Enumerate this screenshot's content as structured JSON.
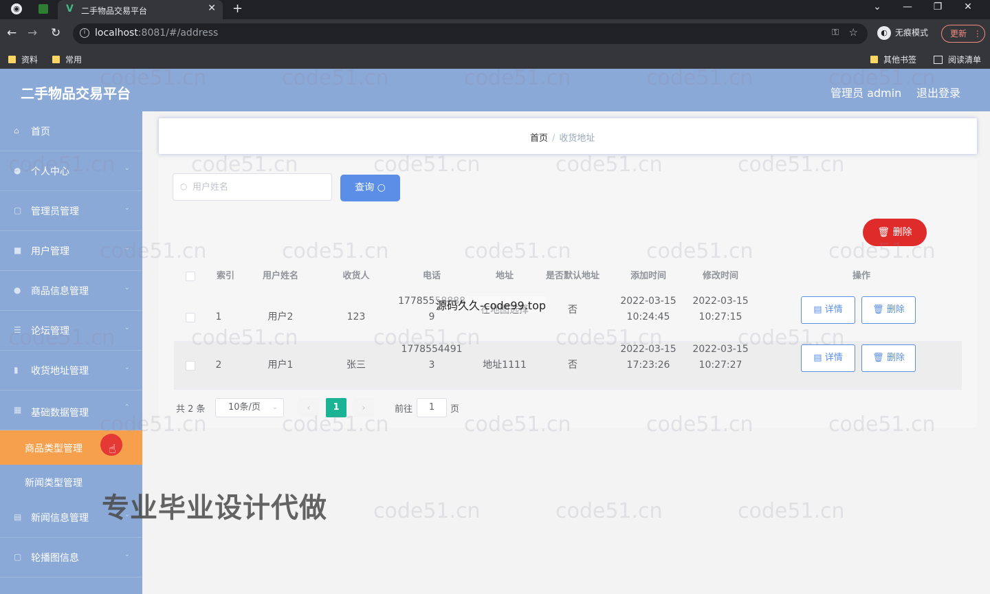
{
  "browser": {
    "tab_title": "二手物品交易平台",
    "address": {
      "host": "localhost",
      "rest": ":8081/#/address"
    },
    "incognito_label": "无痕模式",
    "update_label": "更新",
    "bookmarks": [
      "资料",
      "常用"
    ],
    "other_bookmarks": "其他书签",
    "reading_list": "阅读清单"
  },
  "header": {
    "brand": "二手物品交易平台",
    "admin": "管理员 admin",
    "logout": "退出登录"
  },
  "sidebar": {
    "items": [
      {
        "label": "首页",
        "icon": "home-icon"
      },
      {
        "label": "个人中心",
        "icon": "user-icon"
      },
      {
        "label": "管理员管理",
        "icon": "admin-icon"
      },
      {
        "label": "用户管理",
        "icon": "users-icon"
      },
      {
        "label": "商品信息管理",
        "icon": "goods-icon"
      },
      {
        "label": "论坛管理",
        "icon": "forum-icon"
      },
      {
        "label": "收货地址管理",
        "icon": "chart-icon"
      },
      {
        "label": "基础数据管理",
        "icon": "data-icon"
      }
    ],
    "sub_items": [
      {
        "label": "商品类型管理"
      },
      {
        "label": "新闻类型管理"
      }
    ],
    "items_after": [
      {
        "label": "新闻信息管理",
        "icon": "news-icon"
      },
      {
        "label": "轮播图信息",
        "icon": "carousel-icon"
      }
    ]
  },
  "breadcrumb": {
    "home": "首页",
    "sep": "/",
    "current": "收货地址"
  },
  "search": {
    "placeholder": "用户姓名",
    "button": "查询"
  },
  "delete_button": "删除",
  "table": {
    "headers": [
      "索引",
      "用户姓名",
      "收货人",
      "电话",
      "地址",
      "是否默认地址",
      "添加时间",
      "修改时间",
      "操作"
    ],
    "rows": [
      {
        "index": "1",
        "user": "用户2",
        "receiver": "123",
        "phone1": "17785558888",
        "phone2": "9",
        "address": "在地图选择",
        "default": "否",
        "added1": "2022-03-15",
        "added2": "10:24:45",
        "modified1": "2022-03-15",
        "modified2": "10:27:15"
      },
      {
        "index": "2",
        "user": "用户1",
        "receiver": "张三",
        "phone1": "1778554491",
        "phone2": "3",
        "address": "地址1111",
        "default": "否",
        "added1": "2022-03-15",
        "added2": "17:23:26",
        "modified1": "2022-03-15",
        "modified2": "10:27:27"
      }
    ],
    "detail_label": "详情",
    "delete_label": "删除"
  },
  "pager": {
    "total": "共 2 条",
    "page_size": "10条/页",
    "current": "1",
    "goto_label": "前往",
    "goto_value": "1",
    "page_unit": "页"
  },
  "overlays": {
    "src_watermark": "源码久久-code99.top",
    "ad_text": "专业毕业设计代做",
    "watermark": "code51.cn"
  },
  "colors": {
    "header": "#8ba9d6",
    "active_menu": "#f6a04d",
    "primary": "#5b8ee6",
    "danger": "#e02b2b",
    "page_active": "#1ab394"
  }
}
